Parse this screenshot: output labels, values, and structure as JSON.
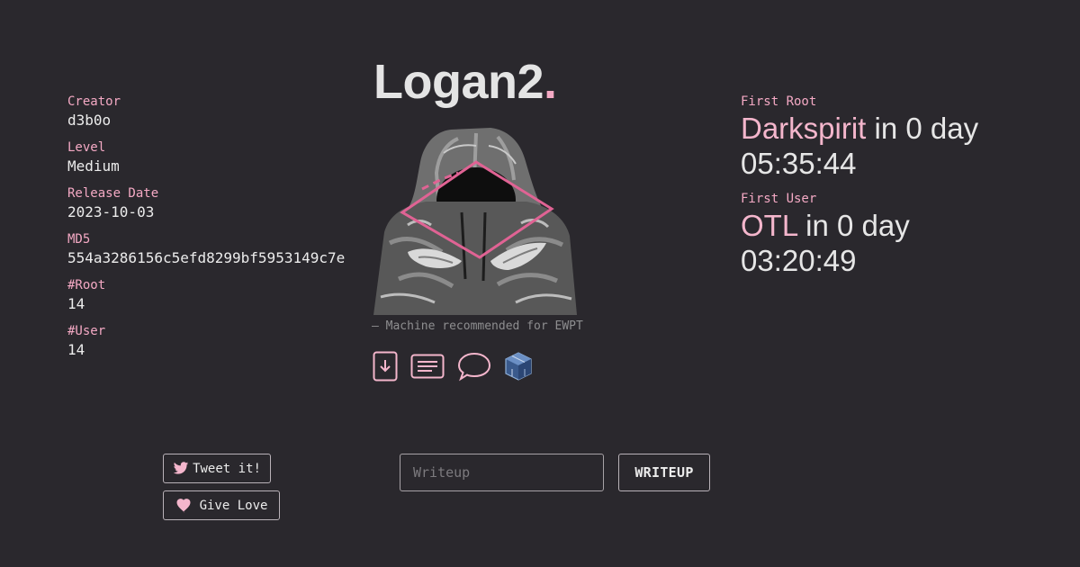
{
  "machine": {
    "name": "Logan2",
    "name_suffix": "."
  },
  "details": [
    {
      "label": "Creator",
      "value": "d3b0o"
    },
    {
      "label": "Level",
      "value": "Medium"
    },
    {
      "label": "Release Date",
      "value": "2023-10-03"
    },
    {
      "label": "MD5",
      "value": "554a3286156c5efd8299bf5953149c7e"
    },
    {
      "label": "#Root",
      "value": "14"
    },
    {
      "label": "#User",
      "value": "14"
    }
  ],
  "quote": "— Machine recommended for EWPT",
  "actions": [
    {
      "icon": "download-icon"
    },
    {
      "icon": "document-icon"
    },
    {
      "icon": "chat-bubble-icon"
    },
    {
      "icon": "virtualbox-icon"
    }
  ],
  "first_root": {
    "label": "First Root",
    "name": "Darkspirit",
    "suffix": " in 0 day",
    "time": "05:35:44"
  },
  "first_user": {
    "label": "First User",
    "name": "OTL",
    "suffix": " in 0 day",
    "time": "03:20:49"
  },
  "social": {
    "tweet_label": "Tweet it!",
    "love_label": "Give Love",
    "twitter_icon": "twitter-bird-icon",
    "heart_icon": "heart-icon"
  },
  "writeup": {
    "placeholder": "Writeup",
    "value": "",
    "button_label": "WRITEUP"
  },
  "colors": {
    "background": "#2a282d",
    "accent": "#f4a9c4",
    "text": "#e6e6e6",
    "muted": "#8e8e90"
  }
}
